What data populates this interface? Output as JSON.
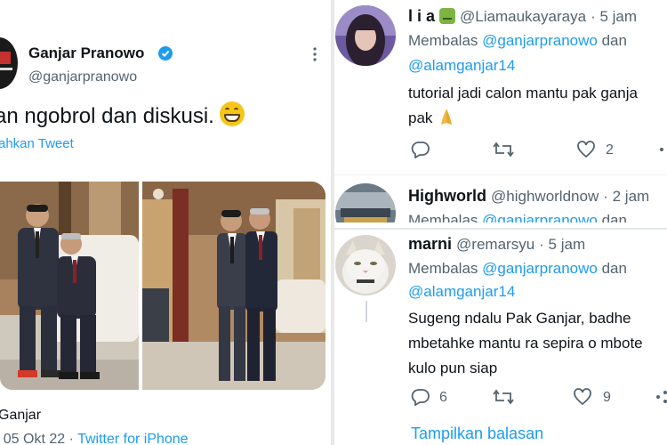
{
  "left_tweet": {
    "author_name": "Ganjar Pranowo",
    "handle": "@ganjarpranowo",
    "text": "an ngobrol dan diskusi.",
    "translate_label": "ahkan Tweet",
    "location": "Ganjar",
    "date": "· 05 Okt 22 · ",
    "app": "Twitter for iPhone",
    "colors": {
      "accent": "#1d9bf0",
      "verified": "#1d9bf0"
    }
  },
  "replies": [
    {
      "name": "l i a",
      "handle": "@Liamaukayaraya",
      "time": "· 5 jam",
      "replying_prefix": "Membalas ",
      "mention1": "@ganjarpranowo",
      "and": " dan",
      "mention2": "@alamganjar14",
      "body_line1": "tutorial jadi calon mantu pak ganja",
      "body_line2": "pak",
      "likes": "2"
    },
    {
      "name": "Highworld",
      "handle": "@highworldnow",
      "time": "· 2 jam",
      "replying_prefix": "Membalas ",
      "mention1": "@ganjarpranowo",
      "and": " dan"
    },
    {
      "name": "marni",
      "handle": "@remarsyu",
      "time": "· 5 jam",
      "replying_prefix": "Membalas ",
      "mention1": "@ganjarpranowo",
      "and": " dan",
      "mention2": "@alamganjar14",
      "body_line1": "Sugeng ndalu Pak Ganjar, badhe",
      "body_line2": "mbetahke mantu ra sepira o mbote",
      "body_line3": "kulo pun siap",
      "replies_count": "6",
      "likes": "9",
      "show_replies": "Tampilkan balasan"
    }
  ]
}
